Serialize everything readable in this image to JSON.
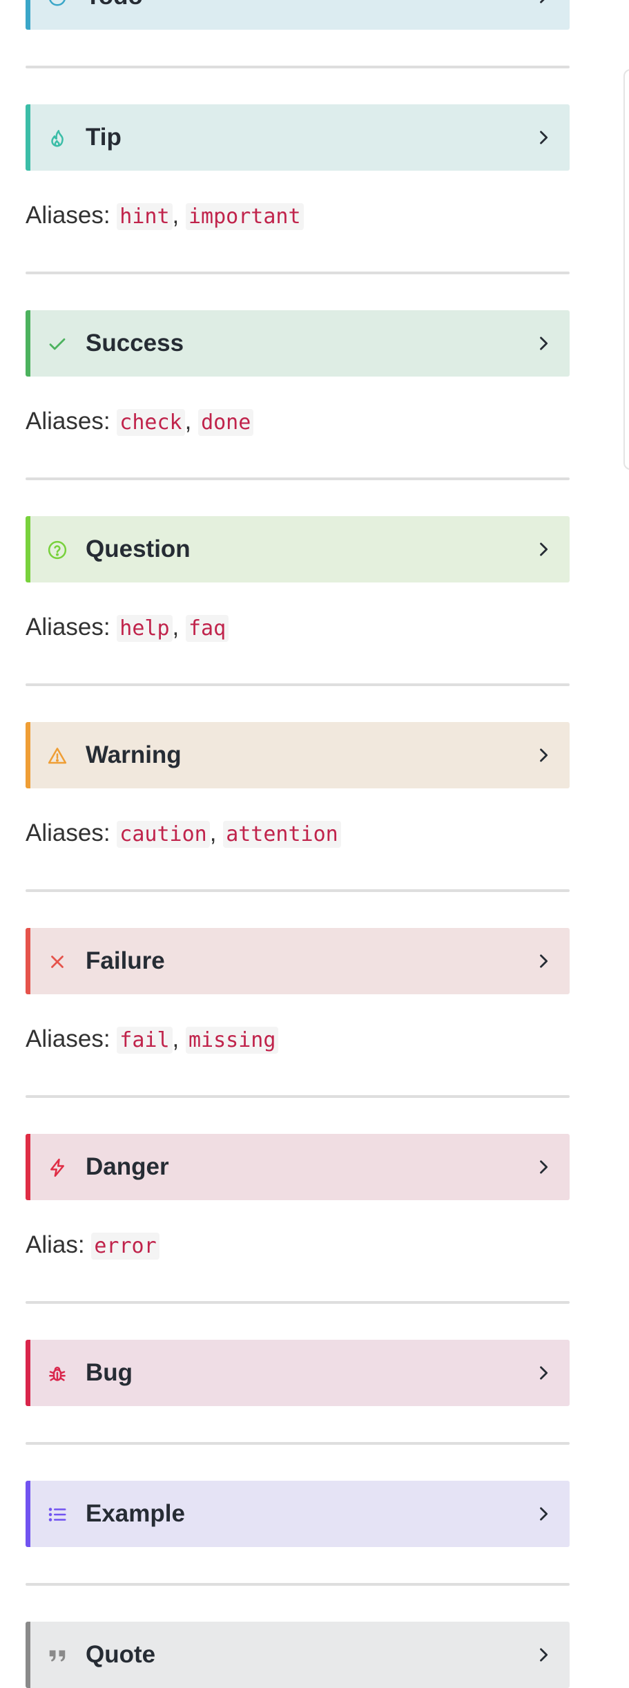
{
  "callouts": [
    {
      "title": "Todo",
      "icon": "info-circle-icon",
      "bg": "#dcecf1",
      "accent": "#3aa6c8",
      "aliases_label": "",
      "aliases": []
    },
    {
      "title": "Tip",
      "icon": "fire-icon",
      "bg": "#ddedec",
      "accent": "#3bbda7",
      "aliases_label": "Aliases:",
      "aliases": [
        "hint",
        "important"
      ]
    },
    {
      "title": "Success",
      "icon": "check-icon",
      "bg": "#deede4",
      "accent": "#4cb25e",
      "aliases_label": "Aliases:",
      "aliases": [
        "check",
        "done"
      ]
    },
    {
      "title": "Question",
      "icon": "help-circle-icon",
      "bg": "#e4f0dd",
      "accent": "#78d13c",
      "aliases_label": "Aliases:",
      "aliases": [
        "help",
        "faq"
      ]
    },
    {
      "title": "Warning",
      "icon": "alert-triangle-icon",
      "bg": "#f1e8dd",
      "accent": "#ef9e35",
      "aliases_label": "Aliases:",
      "aliases": [
        "caution",
        "attention"
      ]
    },
    {
      "title": "Failure",
      "icon": "x-icon",
      "bg": "#f1e1e1",
      "accent": "#e5534b",
      "aliases_label": "Aliases:",
      "aliases": [
        "fail",
        "missing"
      ]
    },
    {
      "title": "Danger",
      "icon": "zap-icon",
      "bg": "#f0dde2",
      "accent": "#df2d45",
      "aliases_label": "Alias:",
      "aliases": [
        "error"
      ]
    },
    {
      "title": "Bug",
      "icon": "bug-icon",
      "bg": "#efdde5",
      "accent": "#d9254b",
      "aliases_label": "",
      "aliases": []
    },
    {
      "title": "Example",
      "icon": "list-icon",
      "bg": "#e5e3f5",
      "accent": "#7153f0",
      "aliases_label": "",
      "aliases": []
    },
    {
      "title": "Quote",
      "icon": "quote-icon",
      "bg": "#e8e9ea",
      "accent": "#8a8a8a",
      "aliases_label": "",
      "aliases": []
    }
  ]
}
